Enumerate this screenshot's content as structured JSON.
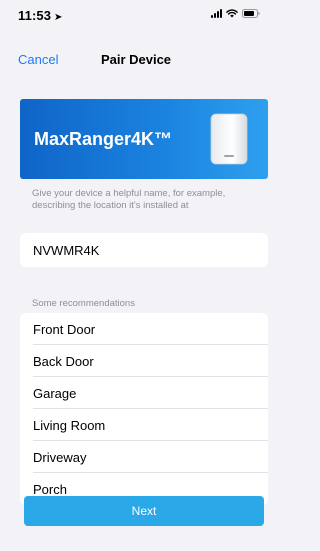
{
  "status_bar": {
    "time": "11:53",
    "location_icon": "location-arrow-icon",
    "signal_icon": "cellular-signal-icon",
    "wifi_icon": "wifi-icon",
    "battery_icon": "battery-icon"
  },
  "nav": {
    "cancel_label": "Cancel",
    "title": "Pair Device"
  },
  "banner": {
    "device_name": "MaxRanger4K™",
    "device_image": "camera-device-image"
  },
  "form": {
    "hint": "Give your device a helpful name, for example, describing the location it's installed at",
    "name_value": "NVWMR4K"
  },
  "recommendations": {
    "header": "Some recommendations",
    "items": [
      {
        "label": "Front Door"
      },
      {
        "label": "Back Door"
      },
      {
        "label": "Garage"
      },
      {
        "label": "Living Room"
      },
      {
        "label": "Driveway"
      },
      {
        "label": "Porch"
      }
    ]
  },
  "footer": {
    "next_label": "Next"
  },
  "colors": {
    "accent_blue": "#1f7bf0",
    "banner_blue": "#1b84e0",
    "next_button": "#2aa8e8",
    "background": "#f2f2f7"
  }
}
